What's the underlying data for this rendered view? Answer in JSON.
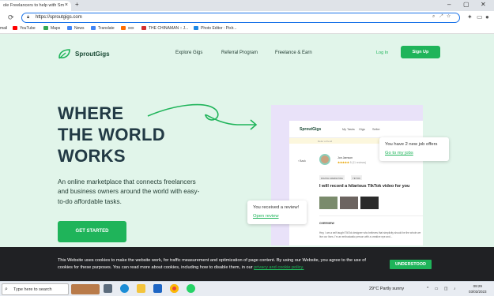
{
  "browser": {
    "tab_title": "ole Freelancers to help with Sm",
    "tab_close": "×",
    "new_tab": "+",
    "window_controls": [
      "–",
      "▢",
      "✕"
    ],
    "url": "https://sproutgigs.com"
  },
  "bookmarks": [
    {
      "label": "mail",
      "color": "#ea4335"
    },
    {
      "label": "YouTube",
      "color": "#ff0000"
    },
    {
      "label": "Maps",
      "color": "#34a853"
    },
    {
      "label": "News",
      "color": "#4285f4"
    },
    {
      "label": "Translate",
      "color": "#4285f4"
    },
    {
      "label": "xxx",
      "color": "#ff6d00"
    },
    {
      "label": "THE CHINAMAN :: J...",
      "color": "#d32f2f"
    },
    {
      "label": "Photo Editor : Pixlr...",
      "color": "#1e88e5"
    }
  ],
  "site": {
    "logo": "SproutGigs",
    "nav": [
      "Explore Gigs",
      "Referral Program",
      "Freelance & Earn"
    ],
    "login": "Log In",
    "signup": "Sign Up",
    "hero_lines": [
      "WHERE",
      "THE WORLD",
      "WORKS"
    ],
    "description": "An online marketplace that connects freelancers and business owners around the world with easy-to-do affordable tasks.",
    "cta": "GET STARTED"
  },
  "preview": {
    "logo": "SproutGigs",
    "nav": [
      "My Tasks",
      "Gigs",
      "Seller"
    ],
    "strip": "Refer a friend",
    "back": "Back",
    "seller_name": "Jon Jarnson",
    "stars": "★★★★★",
    "rating": "5 (11 reviews)",
    "tags": [
      "DIGITAL MARKETING",
      "TIKTOK"
    ],
    "gig_title": "I will record a hilarious TikTok video for you",
    "overview": "OVERVIEW",
    "overview_text": "Hey, I am a self taught TikTok designer who believes that simplicity should be the whole we live our lives. I'm an enthusiastic person with a creative eye and..."
  },
  "popups": {
    "offers": {
      "text": "You have 2 new job offers",
      "link": "Go to my jobs"
    },
    "review": {
      "text": "You received a review!",
      "link": "Open review"
    }
  },
  "cookie": {
    "text": "This Website uses cookies to make the website work, for traffic measurement and optimization of page content. By using our Website, you agree to the use of cookies for these purposes. You can read more about cookies, including how to disable them, in our",
    "link": "privacy and cookie policy.",
    "button": "UNDERSTOOD"
  },
  "taskbar": {
    "search_placeholder": "Type here to search",
    "weather": "29°C  Partly sunny",
    "tray": "^ ▭ ◫ ♪",
    "time": "09:29",
    "date": "03/03/2023"
  },
  "colors": {
    "brand": "#1fb45a",
    "hero_bg": "#e1f5ea",
    "dark_text": "#223a45"
  }
}
